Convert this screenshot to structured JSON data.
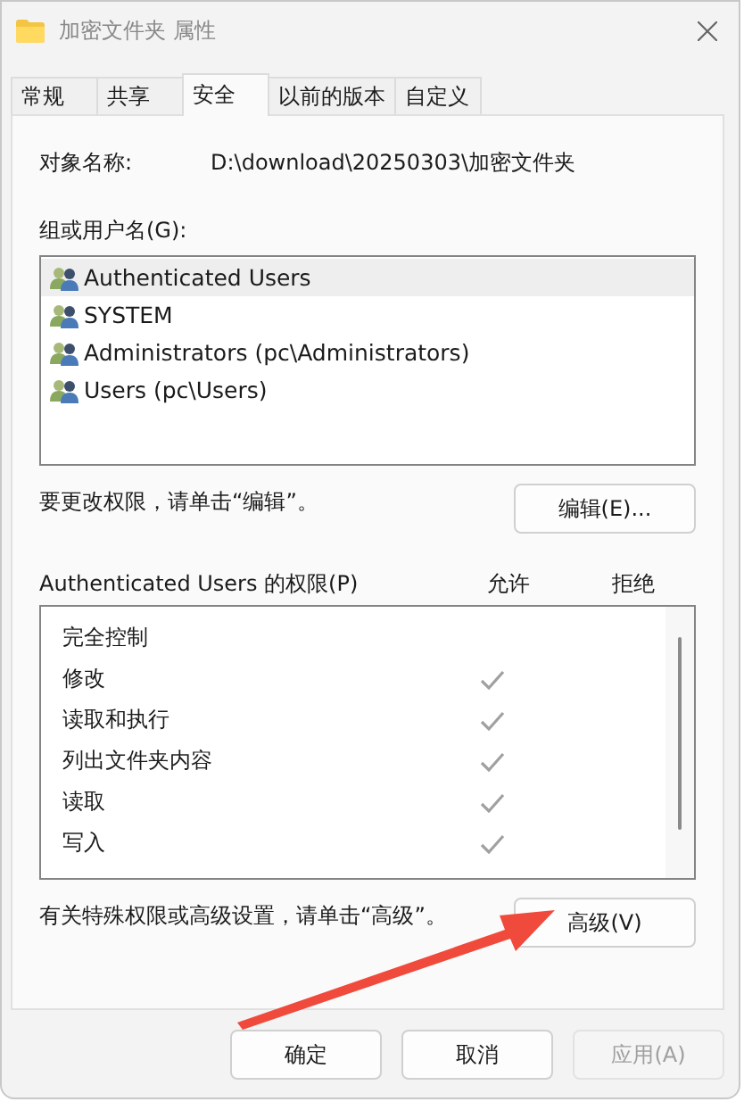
{
  "window": {
    "title": "加密文件夹 属性"
  },
  "tabs": [
    {
      "label": "常规",
      "selected": false
    },
    {
      "label": "共享",
      "selected": false
    },
    {
      "label": "安全",
      "selected": true
    },
    {
      "label": "以前的版本",
      "selected": false
    },
    {
      "label": "自定义",
      "selected": false
    }
  ],
  "object_name": {
    "label": "对象名称:",
    "value": "D:\\download\\20250303\\加密文件夹"
  },
  "groups": {
    "label": "组或用户名(G):",
    "items": [
      {
        "name": "Authenticated Users",
        "selected": true
      },
      {
        "name": "SYSTEM",
        "selected": false
      },
      {
        "name": "Administrators (pc\\Administrators)",
        "selected": false
      },
      {
        "name": "Users (pc\\Users)",
        "selected": false
      }
    ]
  },
  "edit_hint": "要更改权限，请单击“编辑”。",
  "edit_button": "编辑(E)...",
  "permissions": {
    "title": "Authenticated Users 的权限(P)",
    "allow_label": "允许",
    "deny_label": "拒绝",
    "rows": [
      {
        "name": "完全控制",
        "allow": false
      },
      {
        "name": "修改",
        "allow": true
      },
      {
        "name": "读取和执行",
        "allow": true
      },
      {
        "name": "列出文件夹内容",
        "allow": true
      },
      {
        "name": "读取",
        "allow": true
      },
      {
        "name": "写入",
        "allow": true
      }
    ]
  },
  "advanced_hint": "有关特殊权限或高级设置，请单击“高级”。",
  "advanced_button": "高级(V)",
  "buttons": [
    {
      "label": "确定",
      "disabled": false
    },
    {
      "label": "取消",
      "disabled": false
    },
    {
      "label": "应用(A)",
      "disabled": true
    }
  ]
}
